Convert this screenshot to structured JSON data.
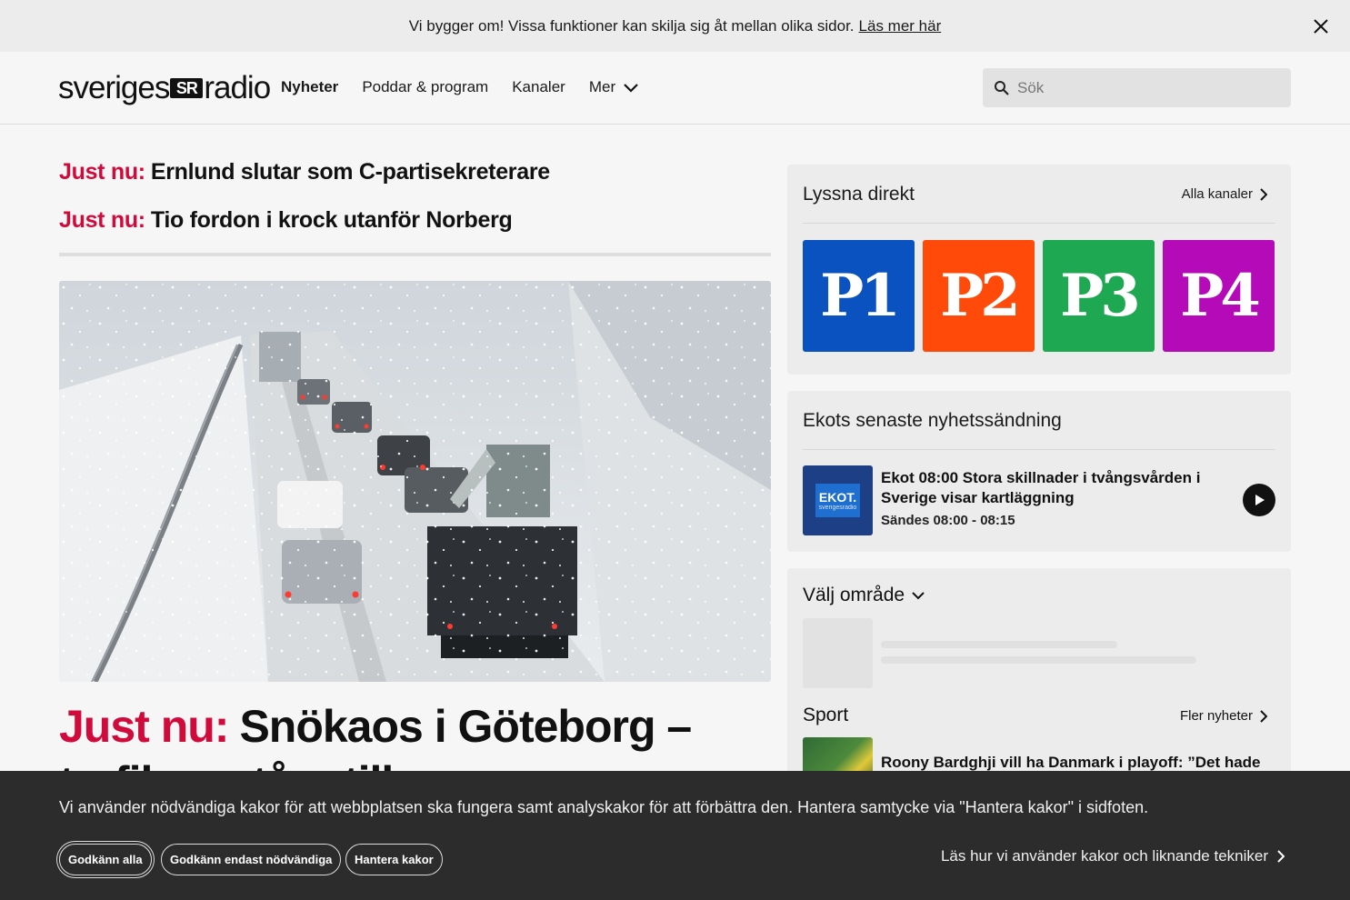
{
  "banner": {
    "text": "Vi bygger om! Vissa funktioner kan skilja sig åt mellan olika sidor.",
    "link": "Läs mer här"
  },
  "header": {
    "logo_left": "sveriges",
    "logo_mark": "SR",
    "logo_right": "radio",
    "nav": [
      {
        "label": "Nyheter",
        "active": true
      },
      {
        "label": "Poddar & program"
      },
      {
        "label": "Kanaler"
      },
      {
        "label": "Mer"
      }
    ],
    "search_placeholder": "Sök"
  },
  "flash": [
    {
      "tag": "Just nu:",
      "text": "Ernlund slutar som C-partisekreterare"
    },
    {
      "tag": "Just nu:",
      "text": "Tio fordon i krock utanför Norberg"
    }
  ],
  "headline": {
    "tag": "Just nu:",
    "text": "Snökaos i Göteborg – trafiken står still"
  },
  "listen": {
    "title": "Lyssna direkt",
    "link": "Alla kanaler",
    "channels": [
      {
        "label": "P1",
        "color": "#0b52c1"
      },
      {
        "label": "P2",
        "color": "#ff4a0a"
      },
      {
        "label": "P3",
        "color": "#1fa852"
      },
      {
        "label": "P4",
        "color": "#b40ab8"
      }
    ]
  },
  "ekot": {
    "title": "Ekots senaste nyhetssändning",
    "thumb_label": "EKOT.",
    "thumb_sub": "sverigesradio",
    "item_title": "Ekot 08:00 Stora skillnader i tvångsvården i Sverige visar kartläggning",
    "item_time": "Sändes 08:00 - 08:15"
  },
  "area": {
    "title": "Välj område"
  },
  "sport": {
    "title": "Sport",
    "link": "Fler nyheter",
    "item_title": "Roony Bardghji vill ha Danmark i playoff: ”Det hade"
  },
  "cookie": {
    "text": "Vi använder nödvändiga kakor för att webbplatsen ska fungera samt analyskakor för att förbättra den. Hantera samtycke via \"Hantera kakor\" i sidfoten.",
    "accept_all": "Godkänn alla",
    "accept_necessary": "Godkänn endast nödvändiga",
    "manage": "Hantera kakor",
    "info_link": "Läs hur vi använder kakor och liknande tekniker"
  },
  "colors": {
    "accent_red": "#d10a3c",
    "cookie_bg": "#2c2c2c"
  }
}
